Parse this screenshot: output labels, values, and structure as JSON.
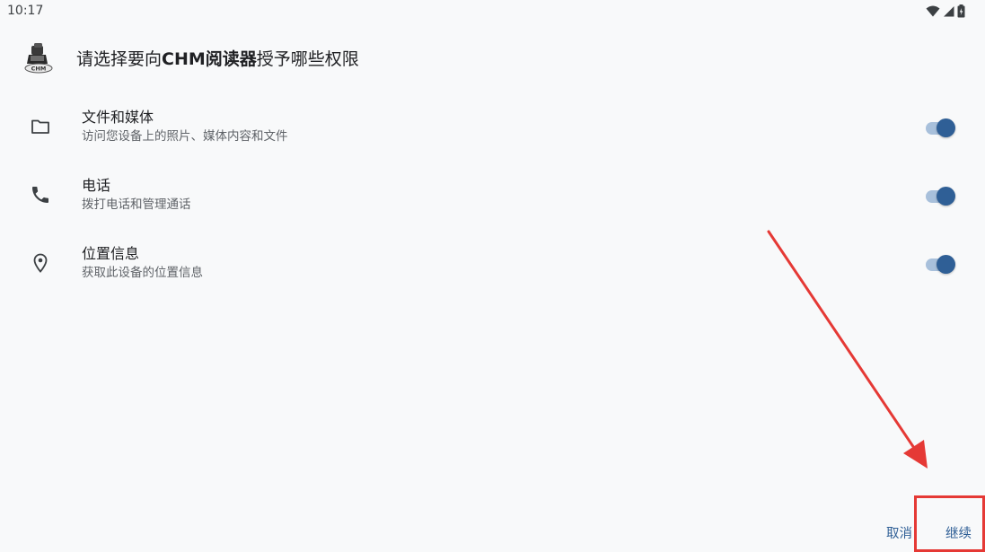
{
  "status_bar": {
    "time": "10:17",
    "icons": [
      "wifi-icon",
      "cell-signal-icon",
      "battery-icon"
    ]
  },
  "header": {
    "app_icon": "chm-reader-app-icon",
    "app_icon_label": "CHM",
    "title_prefix": "请选择要向",
    "app_name": "CHM阅读器",
    "title_suffix": "授予哪些权限"
  },
  "permissions": [
    {
      "icon": "folder-icon",
      "title": "文件和媒体",
      "subtitle": "访问您设备上的照片、媒体内容和文件",
      "enabled": true
    },
    {
      "icon": "phone-icon",
      "title": "电话",
      "subtitle": "拨打电话和管理通话",
      "enabled": true
    },
    {
      "icon": "location-pin-icon",
      "title": "位置信息",
      "subtitle": "获取此设备的位置信息",
      "enabled": true
    }
  ],
  "actions": {
    "cancel_label": "取消",
    "continue_label": "继续"
  },
  "colors": {
    "accent": "#2f5f96",
    "toggle_track": "#a8c0db",
    "annotation": "#e53935",
    "background": "#f8f9fa"
  }
}
